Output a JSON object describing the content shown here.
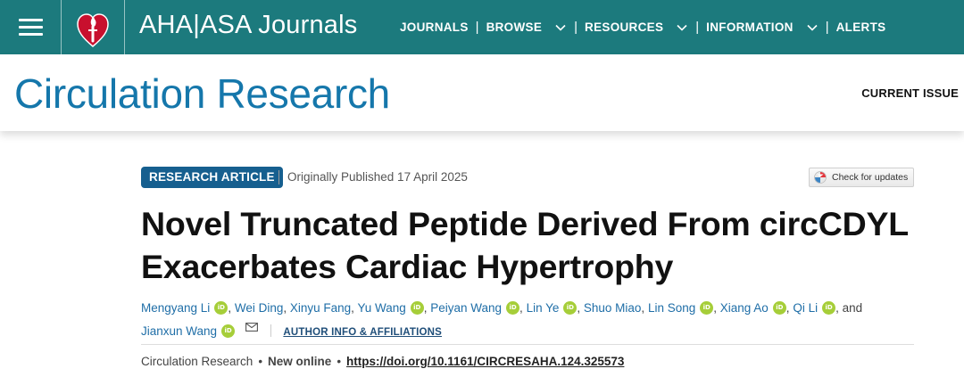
{
  "topbar": {
    "brand": "AHA|ASA Journals",
    "nav": [
      {
        "label": "JOURNALS",
        "dropdown": false
      },
      {
        "label": "BROWSE",
        "dropdown": true
      },
      {
        "label": "RESOURCES",
        "dropdown": true
      },
      {
        "label": "INFORMATION",
        "dropdown": true
      },
      {
        "label": "ALERTS",
        "dropdown": false
      }
    ],
    "separator": "|"
  },
  "journal": {
    "title": "Circulation Research",
    "current_issue": "CURRENT ISSUE"
  },
  "article": {
    "badge": "RESEARCH ARTICLE",
    "published": "Originally Published 17 April 2025",
    "check_updates": "Check for updates",
    "title": "Novel Truncated Peptide Derived From circCDYL Exacerbates Cardiac Hypertrophy",
    "authors": [
      {
        "name": "Mengyang Li",
        "orcid": true
      },
      {
        "name": "Wei Ding",
        "orcid": false
      },
      {
        "name": "Xinyu Fang",
        "orcid": false
      },
      {
        "name": "Yu Wang",
        "orcid": true
      },
      {
        "name": "Peiyan Wang",
        "orcid": true
      },
      {
        "name": "Lin Ye",
        "orcid": true
      },
      {
        "name": "Shuo Miao",
        "orcid": false
      },
      {
        "name": "Lin Song",
        "orcid": true
      },
      {
        "name": "Xiang Ao",
        "orcid": true
      },
      {
        "name": "Qi Li",
        "orcid": true
      },
      {
        "name": "Jianxun Wang",
        "orcid": true
      }
    ],
    "and_text": "and",
    "author_info_link": "AUTHOR INFO & AFFILIATIONS",
    "journal_name": "Circulation Research",
    "status": "New online",
    "doi": "https://doi.org/10.1161/CIRCRESAHA.124.325573"
  },
  "icons": {
    "menu": "hamburger-menu-icon",
    "logo": "aha-heart-torch-logo",
    "orcid": "orcid-icon",
    "orcid_text": "iD",
    "mail": "envelope-icon",
    "chevron": "chevron-down-icon"
  },
  "colors": {
    "topbar": "#1c7a7d",
    "journal_title": "#1577ab",
    "badge": "#165f8f",
    "author_link": "#1f6ea7",
    "orcid": "#a6ce39",
    "logo_red": "#c8102e"
  }
}
